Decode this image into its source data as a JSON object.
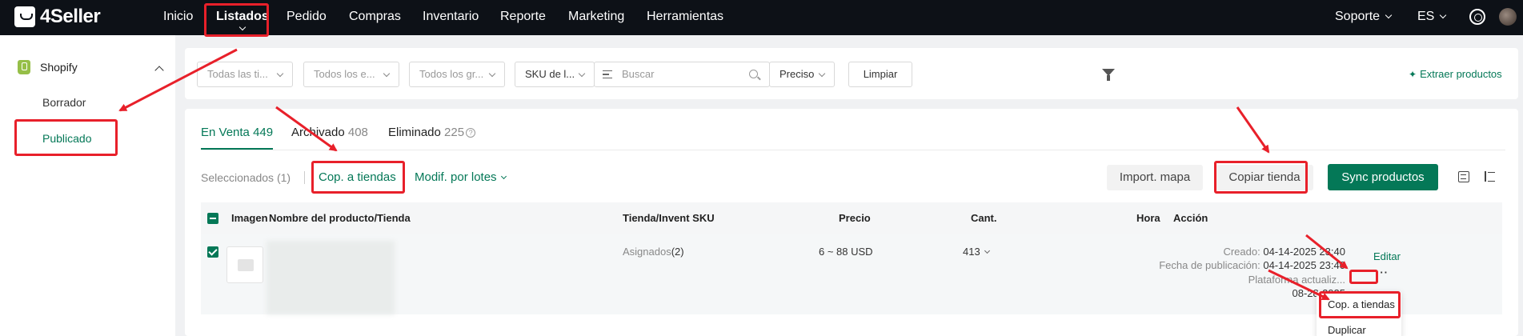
{
  "brand": {
    "name": "4Seller"
  },
  "topnav": {
    "items": [
      "Inicio",
      "Listados",
      "Pedido",
      "Compras",
      "Inventario",
      "Reporte",
      "Marketing",
      "Herramientas"
    ],
    "support": "Soporte",
    "language": "ES"
  },
  "sidebar": {
    "platform": "Shopify",
    "items": [
      "Borrador",
      "Publicado"
    ]
  },
  "filters": {
    "store_select": "Todas las ti...",
    "status_select": "Todos los e...",
    "group_select": "Todos los gr...",
    "sku_select": "SKU de l...",
    "search_placeholder": "Buscar",
    "price_select": "Preciso",
    "clear_button": "Limpiar",
    "extract_link": "Extraer productos"
  },
  "tabs": [
    {
      "label": "En Venta",
      "count": "449"
    },
    {
      "label": "Archivado",
      "count": "408"
    },
    {
      "label": "Eliminado",
      "count": "225"
    }
  ],
  "toolbar": {
    "selected": "Seleccionados (1)",
    "copy_to_stores": "Cop. a tiendas",
    "bulk_edit": "Modif. por lotes",
    "import_map": "Import. mapa",
    "copy_store": "Copiar tienda",
    "sync_products": "Sync productos"
  },
  "table": {
    "headers": {
      "image": "Imagen",
      "name": "Nombre del producto/Tienda",
      "store_sku": "Tienda/Invent SKU",
      "price": "Precio",
      "qty": "Cant.",
      "time": "Hora",
      "action": "Acción"
    },
    "rows": [
      {
        "assigned_label": "Asignados",
        "assigned_count": "(2)",
        "price": "6 ~ 88 USD",
        "qty": "413",
        "created_label": "Creado:",
        "created_value": "04-14-2025 23:40",
        "published_label": "Fecha de publicación:",
        "published_value": "04-14-2025 23:40",
        "platform_label": "Plataforma actualiz...",
        "platform_value": "08-28-2025",
        "edit": "Editar",
        "more": "···"
      }
    ]
  },
  "row_menu": {
    "items": [
      "Cop. a tiendas",
      "Duplicar"
    ]
  },
  "colors": {
    "brand_green": "#047857",
    "annotation_red": "#e8202a",
    "topnav_bg": "#0d1117"
  }
}
